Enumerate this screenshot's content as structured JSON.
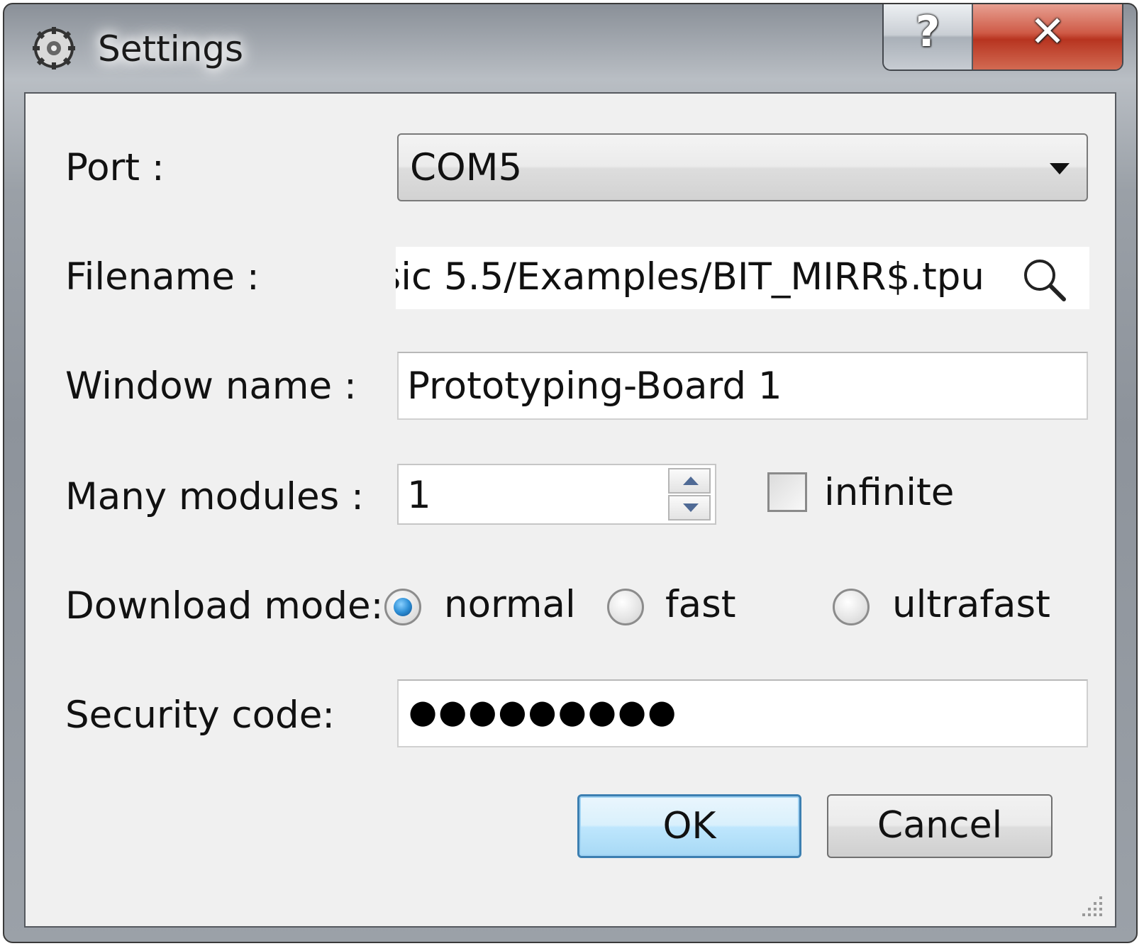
{
  "window": {
    "title": "Settings",
    "help_glyph": "?",
    "close_glyph": "✕"
  },
  "form": {
    "port": {
      "label": "Port :",
      "value": "COM5"
    },
    "filename": {
      "label": "Filename :",
      "value": "sic 5.5/Examples/BIT_MIRR$.tpu"
    },
    "window_name": {
      "label": "Window name :",
      "value": "Prototyping-Board 1"
    },
    "modules": {
      "label": "Many modules :",
      "value": "1",
      "infinite_label": "infinite",
      "infinite_checked": false
    },
    "download_mode": {
      "label": "Download mode:",
      "options": [
        {
          "label": "normal",
          "selected": true
        },
        {
          "label": "fast",
          "selected": false
        },
        {
          "label": "ultrafast",
          "selected": false
        }
      ]
    },
    "security": {
      "label": "Security code:",
      "masked_value": "●●●●●●●●●"
    }
  },
  "buttons": {
    "ok": "OK",
    "cancel": "Cancel"
  },
  "icons": {
    "app": "gear-cog-icon",
    "search": "search-icon",
    "dropdown": "chevron-down-icon",
    "help": "help-icon",
    "close": "close-icon"
  },
  "colors": {
    "close_button": "#c9483a",
    "default_button_border": "#3c7fb1",
    "radio_selected": "#2e8fd6",
    "spin_arrow": "#4f6a95"
  }
}
